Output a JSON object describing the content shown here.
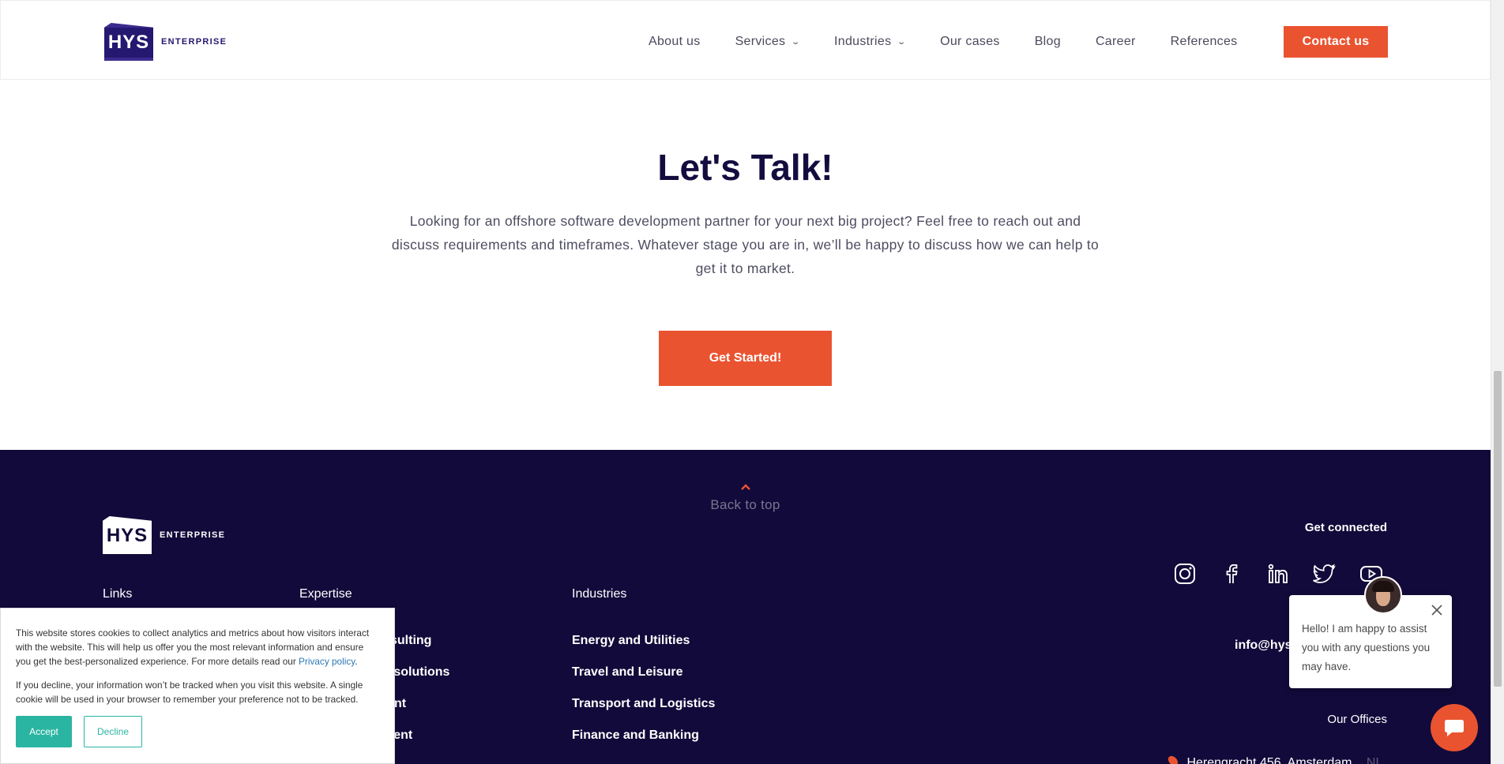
{
  "header": {
    "logo_mark": "HYS",
    "logo_word": "ENTERPRISE",
    "nav": [
      {
        "label": "About us"
      },
      {
        "label": "Services"
      },
      {
        "label": "Industries"
      },
      {
        "label": "Our cases"
      },
      {
        "label": "Blog"
      },
      {
        "label": "Career"
      },
      {
        "label": "References"
      }
    ],
    "contact_label": "Contact us"
  },
  "talk": {
    "title": "Let's Talk!",
    "text": "Looking for an offshore software development partner for your next big project? Feel free to reach out and discuss requirements and timeframes. Whatever stage you are in, we’ll be happy to discuss how we can help to get it to market.",
    "button": "Get Started!"
  },
  "footer": {
    "back_to_top": "Back to top",
    "logo_mark": "HYS",
    "logo_word": "ENTERPRISE",
    "links_heading": "Links",
    "expertise_heading": "Expertise",
    "expertise_items": [
      "sulting",
      "e solutions",
      "nt",
      "ment"
    ],
    "industries_heading": "Industries",
    "industries_items": [
      "Energy and Utilities",
      "Travel and Leisure",
      "Transport and Logistics",
      "Finance and Banking"
    ],
    "get_connected": "Get connected",
    "socials": [
      "instagram-icon",
      "facebook-icon",
      "linkedin-icon",
      "twitter-icon",
      "youtube-icon"
    ],
    "email": "info@hys",
    "offices_heading": "Our Offices",
    "office_address": "Herengracht 456, Amsterdam",
    "office_country": "NL"
  },
  "cookie": {
    "text1": "This website stores cookies to collect analytics and metrics about how visitors interact with the website. This will help us offer you the most relevant information and ensure you get the best-personalized experience. For more details read our",
    "privacy_link": "Privacy policy",
    "text1_end": ".",
    "text2": "If you decline, your information won’t be tracked when you visit this website. A single cookie will be used in your browser to remember your preference not to be tracked.",
    "accept": "Accept",
    "decline": "Decline"
  },
  "chat": {
    "message": "Hello! I am happy to assist you with any questions you may have."
  },
  "colors": {
    "accent": "#ea5330",
    "navy": "#120a3a",
    "teal": "#2ab5a2"
  }
}
